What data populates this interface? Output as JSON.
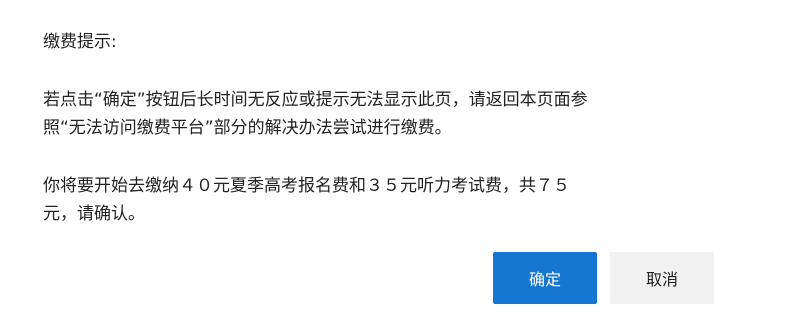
{
  "dialog": {
    "title": "缴费提示:",
    "paragraph1": {
      "line1": "若点击“确定”按钮后长时间无反应或提示无法显示此页，请返回本页面参",
      "line2": "照“无法访问缴费平台”部分的解决办法尝试进行缴费。"
    },
    "paragraph2": {
      "line1": "你将要开始去缴纳４０元夏季高考报名费和３５元听力考试费，共７５",
      "line2": "元，请确认。"
    },
    "buttons": {
      "confirm_label": "确定",
      "cancel_label": "取消"
    }
  },
  "colors": {
    "primary": "#1677d2",
    "secondary_bg": "#f1f1f1",
    "text": "#222222"
  }
}
